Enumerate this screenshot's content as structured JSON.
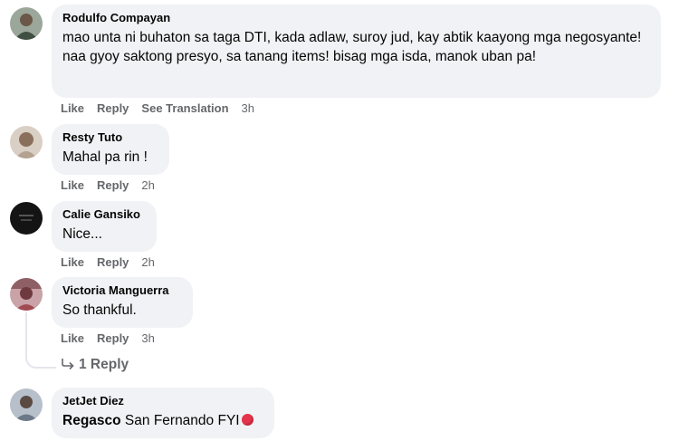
{
  "comments": [
    {
      "author": "Rodulfo Compayan",
      "text": "mao unta ni buhaton sa taga DTI, kada adlaw, suroy jud, kay abtik kaayong mga negosyante! naa gyoy saktong presyo, sa tanang items! bisag mga isda, manok uban pa!",
      "like": "Like",
      "reply": "Reply",
      "translate": "See Translation",
      "time": "3h",
      "avatar_color": "#6b7b6b"
    },
    {
      "author": "Resty Tuto",
      "text": "Mahal pa rin !",
      "like": "Like",
      "reply": "Reply",
      "time": "2h",
      "avatar_color": "#b8a89a"
    },
    {
      "author": "Calie Gansiko",
      "text": "Nice...",
      "like": "Like",
      "reply": "Reply",
      "time": "2h",
      "avatar_color": "#1a1a1a"
    },
    {
      "author": "Victoria Manguerra",
      "text": "So thankful.",
      "like": "Like",
      "reply": "Reply",
      "time": "3h",
      "avatar_color": "#a24a52",
      "replies_label": "1 Reply"
    },
    {
      "author": "JetJet Diez",
      "mention": "Regasco",
      "text": " San Fernando FYI",
      "avatar_color": "#8a95a3"
    }
  ],
  "colors": {
    "bubble": "#f0f2f5",
    "meta": "#65676b",
    "text": "#050505",
    "emoji": "#e4334b"
  }
}
